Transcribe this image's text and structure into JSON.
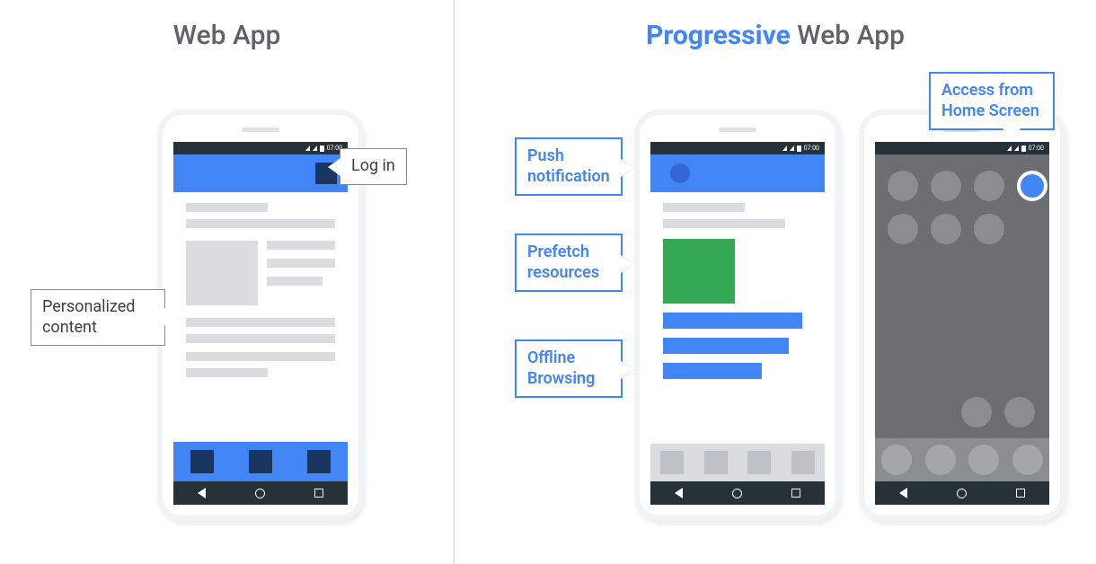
{
  "left": {
    "title": "Web App",
    "callouts": {
      "login": "Log in",
      "personalized": "Personalized content"
    },
    "status_time": "07:00"
  },
  "right": {
    "title_accent": "Progressive",
    "title_rest": " Web App",
    "callouts": {
      "push": "Push notification",
      "prefetch": "Prefetch resources",
      "offline": "Offline Browsing",
      "home": "Access from Home Screen"
    },
    "status_time": "07:00"
  }
}
